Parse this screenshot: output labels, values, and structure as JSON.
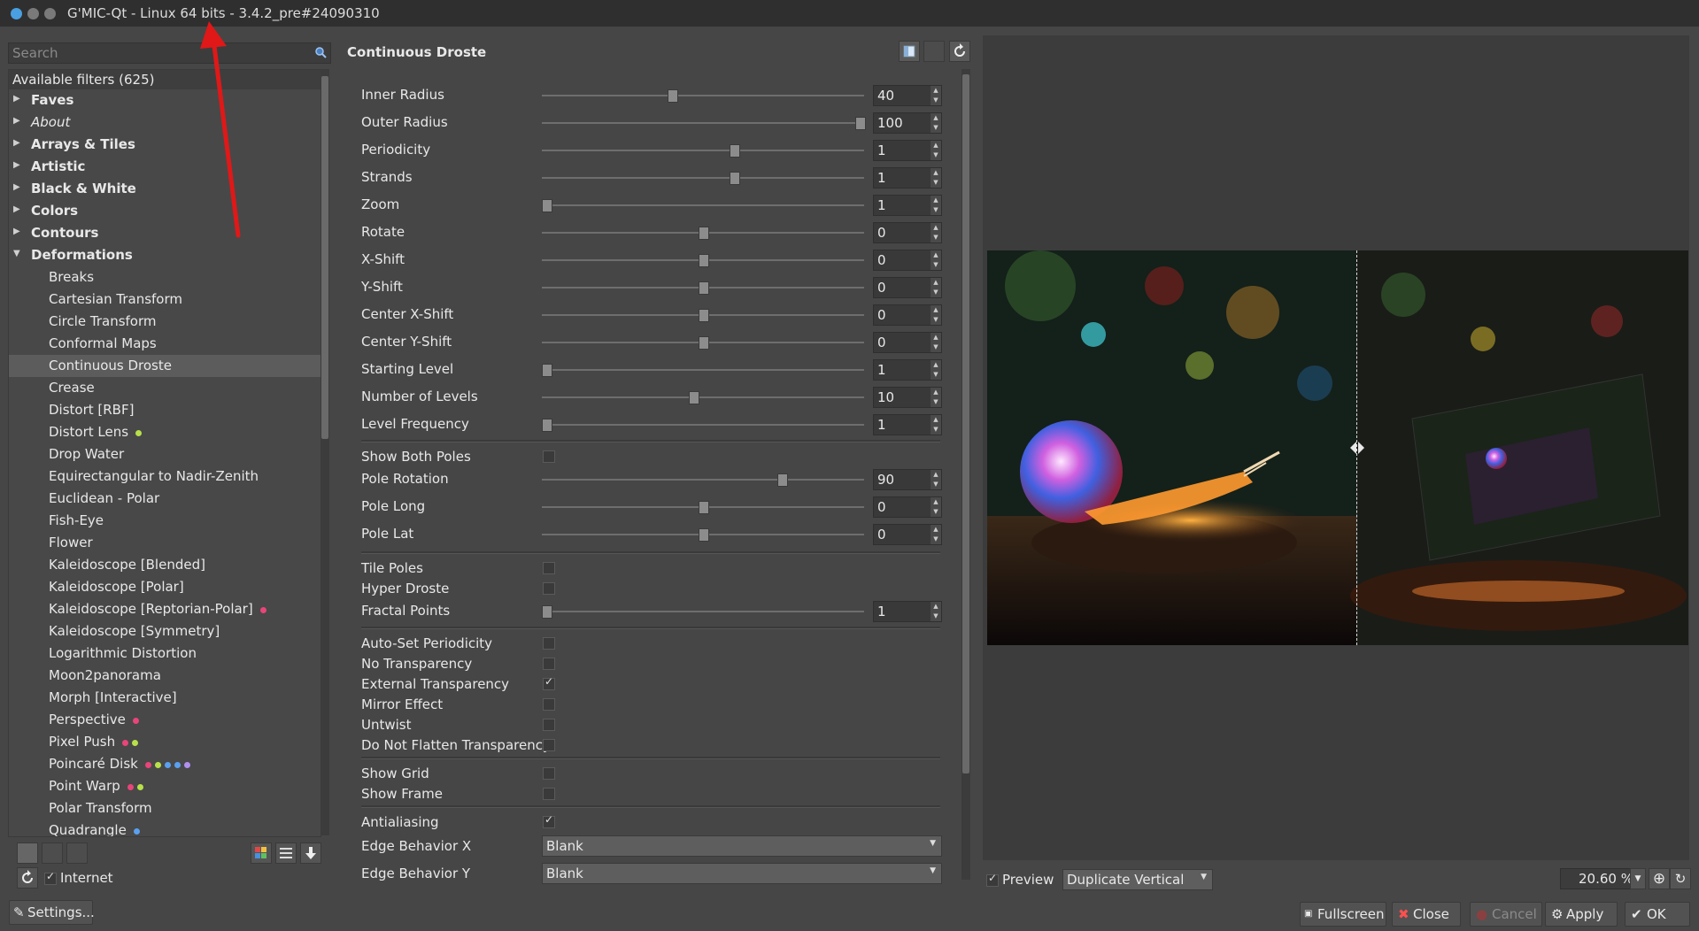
{
  "window": {
    "title": "G'MIC-Qt - Linux 64 bits - 3.4.2_pre#24090310"
  },
  "search": {
    "placeholder": "Search"
  },
  "tree": {
    "header": "Available filters (625)",
    "categories_top": [
      {
        "label": "Faves",
        "italic": false
      },
      {
        "label": "About",
        "italic": true
      },
      {
        "label": "Arrays & Tiles",
        "italic": false
      },
      {
        "label": "Artistic",
        "italic": false
      },
      {
        "label": "Black & White",
        "italic": false
      },
      {
        "label": "Colors",
        "italic": false
      },
      {
        "label": "Contours",
        "italic": false
      },
      {
        "label": "Deformations",
        "italic": false
      }
    ],
    "leaves": [
      {
        "label": "Breaks",
        "dots": []
      },
      {
        "label": "Cartesian Transform",
        "dots": []
      },
      {
        "label": "Circle Transform",
        "dots": []
      },
      {
        "label": "Conformal Maps",
        "dots": []
      },
      {
        "label": "Continuous Droste",
        "dots": [],
        "selected": true
      },
      {
        "label": "Crease",
        "dots": []
      },
      {
        "label": "Distort [RBF]",
        "dots": []
      },
      {
        "label": "Distort Lens",
        "dots": [
          "#b8e04a"
        ]
      },
      {
        "label": "Drop Water",
        "dots": []
      },
      {
        "label": "Equirectangular to Nadir-Zenith",
        "dots": []
      },
      {
        "label": "Euclidean - Polar",
        "dots": []
      },
      {
        "label": "Fish-Eye",
        "dots": []
      },
      {
        "label": "Flower",
        "dots": []
      },
      {
        "label": "Kaleidoscope [Blended]",
        "dots": []
      },
      {
        "label": "Kaleidoscope [Polar]",
        "dots": []
      },
      {
        "label": "Kaleidoscope [Reptorian-Polar]",
        "dots": [
          "#e8457a"
        ]
      },
      {
        "label": "Kaleidoscope [Symmetry]",
        "dots": []
      },
      {
        "label": "Logarithmic Distortion",
        "dots": []
      },
      {
        "label": "Moon2panorama",
        "dots": []
      },
      {
        "label": "Morph [Interactive]",
        "dots": []
      },
      {
        "label": "Perspective",
        "dots": [
          "#e8457a"
        ]
      },
      {
        "label": "Pixel Push",
        "dots": [
          "#e8457a",
          "#b8e04a"
        ]
      },
      {
        "label": "Poincaré Disk",
        "dots": [
          "#e8457a",
          "#b8e04a",
          "#5aa0f0",
          "#5aa0f0",
          "#b090f0"
        ]
      },
      {
        "label": "Point Warp",
        "dots": [
          "#e8457a",
          "#b8e04a"
        ]
      },
      {
        "label": "Polar Transform",
        "dots": []
      },
      {
        "label": "Quadrangle",
        "dots": [
          "#5aa0f0"
        ]
      }
    ]
  },
  "internet": {
    "label": "Internet",
    "checked": true
  },
  "settings_button": "Settings...",
  "filter": {
    "title": "Continuous Droste",
    "sliders_1": [
      {
        "label": "Inner Radius",
        "value": "40",
        "pos": 0.4
      },
      {
        "label": "Outer Radius",
        "value": "100",
        "pos": 1.0
      },
      {
        "label": "Periodicity",
        "value": "1",
        "pos": 0.6
      },
      {
        "label": "Strands",
        "value": "1",
        "pos": 0.6
      },
      {
        "label": "Zoom",
        "value": "1",
        "pos": 0.0
      },
      {
        "label": "Rotate",
        "value": "0",
        "pos": 0.5
      },
      {
        "label": "X-Shift",
        "value": "0",
        "pos": 0.5
      },
      {
        "label": "Y-Shift",
        "value": "0",
        "pos": 0.5
      },
      {
        "label": "Center X-Shift",
        "value": "0",
        "pos": 0.5
      },
      {
        "label": "Center Y-Shift",
        "value": "0",
        "pos": 0.5
      },
      {
        "label": "Starting Level",
        "value": "1",
        "pos": 0.0
      },
      {
        "label": "Number of Levels",
        "value": "10",
        "pos": 0.47
      },
      {
        "label": "Level Frequency",
        "value": "1",
        "pos": 0.0
      }
    ],
    "show_both_poles": {
      "label": "Show Both Poles",
      "checked": false
    },
    "sliders_2": [
      {
        "label": "Pole Rotation",
        "value": "90",
        "pos": 0.75
      },
      {
        "label": "Pole Long",
        "value": "0",
        "pos": 0.5
      },
      {
        "label": "Pole Lat",
        "value": "0",
        "pos": 0.5
      }
    ],
    "checks_1": [
      {
        "label": "Tile Poles",
        "checked": false
      },
      {
        "label": "Hyper Droste",
        "checked": false
      }
    ],
    "fractal_points": {
      "label": "Fractal Points",
      "value": "1",
      "pos": 0.0
    },
    "checks_2": [
      {
        "label": "Auto-Set Periodicity",
        "checked": false
      },
      {
        "label": "No Transparency",
        "checked": false
      },
      {
        "label": "External Transparency",
        "checked": true
      },
      {
        "label": "Mirror Effect",
        "checked": false
      },
      {
        "label": "Untwist",
        "checked": false
      },
      {
        "label": "Do Not Flatten Transparency",
        "checked": false
      }
    ],
    "checks_3": [
      {
        "label": "Show Grid",
        "checked": false
      },
      {
        "label": "Show Frame",
        "checked": false
      }
    ],
    "antialiasing": {
      "label": "Antialiasing",
      "checked": true
    },
    "edge_x": {
      "label": "Edge Behavior X",
      "value": "Blank"
    },
    "edge_y": {
      "label": "Edge Behavior Y",
      "value": "Blank"
    }
  },
  "preview": {
    "label": "Preview",
    "checked": true,
    "mode": "Duplicate Vertical",
    "zoom": "20.60 %"
  },
  "buttons": {
    "fullscreen": "Fullscreen",
    "close": "Close",
    "cancel": "Cancel",
    "apply": "Apply",
    "ok": "OK"
  },
  "colors": {
    "background": "#464646",
    "accent": "#e02020",
    "selection": "#5c5c5c"
  }
}
